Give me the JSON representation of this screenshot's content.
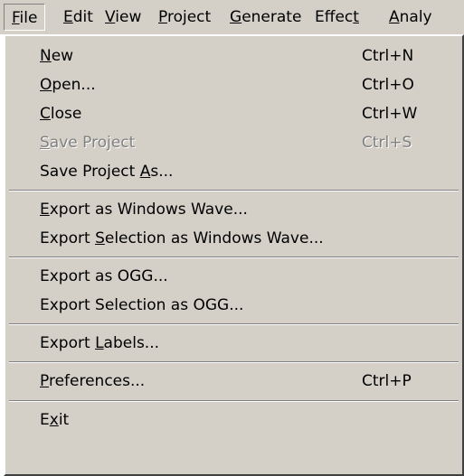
{
  "menubar": {
    "items": [
      {
        "label": "File",
        "mnemonic": 0,
        "active": true
      },
      {
        "label": "Edit",
        "mnemonic": 0
      },
      {
        "label": "View",
        "mnemonic": 0
      },
      {
        "label": "Project",
        "mnemonic": 0
      },
      {
        "label": "Generate",
        "mnemonic": 0
      },
      {
        "label": "Effect",
        "mnemonic": 5
      },
      {
        "label": "Analy",
        "mnemonic": 0
      }
    ]
  },
  "file_menu": {
    "groups": [
      [
        {
          "label": "New",
          "mnemonic": 0,
          "shortcut": "Ctrl+N"
        },
        {
          "label": "Open...",
          "mnemonic": 0,
          "shortcut": "Ctrl+O"
        },
        {
          "label": "Close",
          "mnemonic": 0,
          "shortcut": "Ctrl+W"
        },
        {
          "label": "Save Project",
          "mnemonic": 0,
          "shortcut": "Ctrl+S",
          "disabled": true
        },
        {
          "label": "Save Project As...",
          "mnemonic": 13,
          "shortcut": ""
        }
      ],
      [
        {
          "label": "Export as Windows Wave...",
          "mnemonic": 0,
          "shortcut": ""
        },
        {
          "label": "Export Selection as Windows Wave...",
          "mnemonic": 7,
          "shortcut": ""
        }
      ],
      [
        {
          "label": "Export as OGG...",
          "mnemonic": -1,
          "shortcut": ""
        },
        {
          "label": "Export Selection as OGG...",
          "mnemonic": -1,
          "shortcut": ""
        }
      ],
      [
        {
          "label": "Export Labels...",
          "mnemonic": 7,
          "shortcut": ""
        }
      ],
      [
        {
          "label": "Preferences...",
          "mnemonic": 0,
          "shortcut": "Ctrl+P"
        }
      ],
      [
        {
          "label": "Exit",
          "mnemonic": 1,
          "shortcut": ""
        }
      ]
    ]
  }
}
